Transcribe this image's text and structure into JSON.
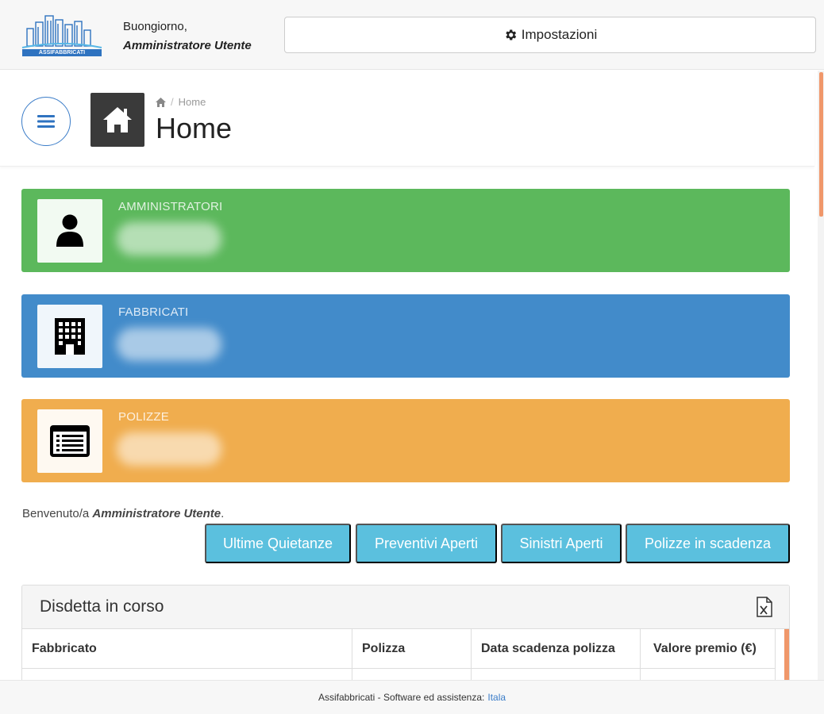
{
  "header": {
    "logo_text": "ASSIFABBRICATI",
    "greeting": "Buongiorno,",
    "user_name": "Amministratore Utente",
    "settings_label": "Impostazioni"
  },
  "page": {
    "breadcrumb_home": "Home",
    "title": "Home"
  },
  "stats": [
    {
      "label": "AMMINISTRATORI",
      "icon": "user-icon",
      "color": "#5cb85c"
    },
    {
      "label": "FABBRICATI",
      "icon": "building-icon",
      "color": "#428bca"
    },
    {
      "label": "POLIZZE",
      "icon": "policy-list-icon",
      "color": "#f0ad4e"
    }
  ],
  "welcome": {
    "prefix": "Benvenuto/a",
    "name": "Amministratore Utente",
    "suffix": "."
  },
  "quick_buttons": [
    "Ultime Quietanze",
    "Preventivi Aperti",
    "Sinistri Aperti",
    "Polizze in scadenza"
  ],
  "panel": {
    "title": "Disdetta in corso",
    "columns": [
      "Fabbricato",
      "Polizza",
      "Data scadenza polizza",
      "Valore premio (€)"
    ]
  },
  "footer": {
    "text": "Assifabbricati - Software ed assistenza:",
    "link": "Itala"
  }
}
